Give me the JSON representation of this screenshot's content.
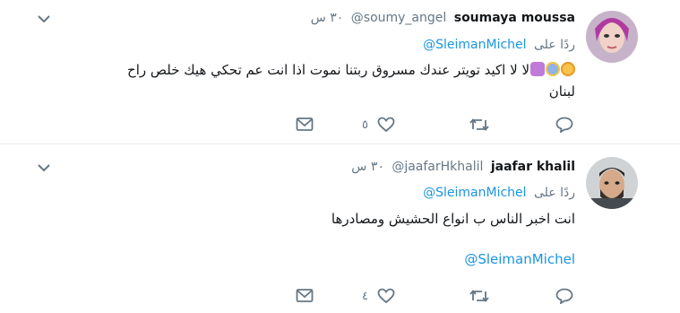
{
  "tweets": [
    {
      "name": "soumaya moussa",
      "handle": "@soumy_angel",
      "time": "٣٠ س",
      "reply_prefix": "ردًا على",
      "reply_to": "@SleimanMichel",
      "text_line1": "لا لا اكيد تويتر عندك مسروق   ربتنا نموت اذا انت عم تحكي هيك خلص راح",
      "text_line2": "لبنان",
      "likes": "٥",
      "emojis": [
        "flushed-face",
        "screaming-face",
        "person-facepalming"
      ]
    },
    {
      "name": "jaafar khalil",
      "handle": "@jaafarHkhalil",
      "time": "٣٠ س",
      "reply_prefix": "ردًا على",
      "reply_to": "@SleimanMichel",
      "text_line1": "انت اخبر الناس  ب انواع الحشيش ومصادرها",
      "link": "@SleimanMichel",
      "likes": "٤"
    }
  ],
  "colors": {
    "link": "#1b95e0",
    "muted": "#657786",
    "divider": "#e6ecf0"
  },
  "icons": [
    "reply-icon",
    "retweet-icon",
    "like-icon",
    "dm-icon",
    "caret-down-icon"
  ]
}
